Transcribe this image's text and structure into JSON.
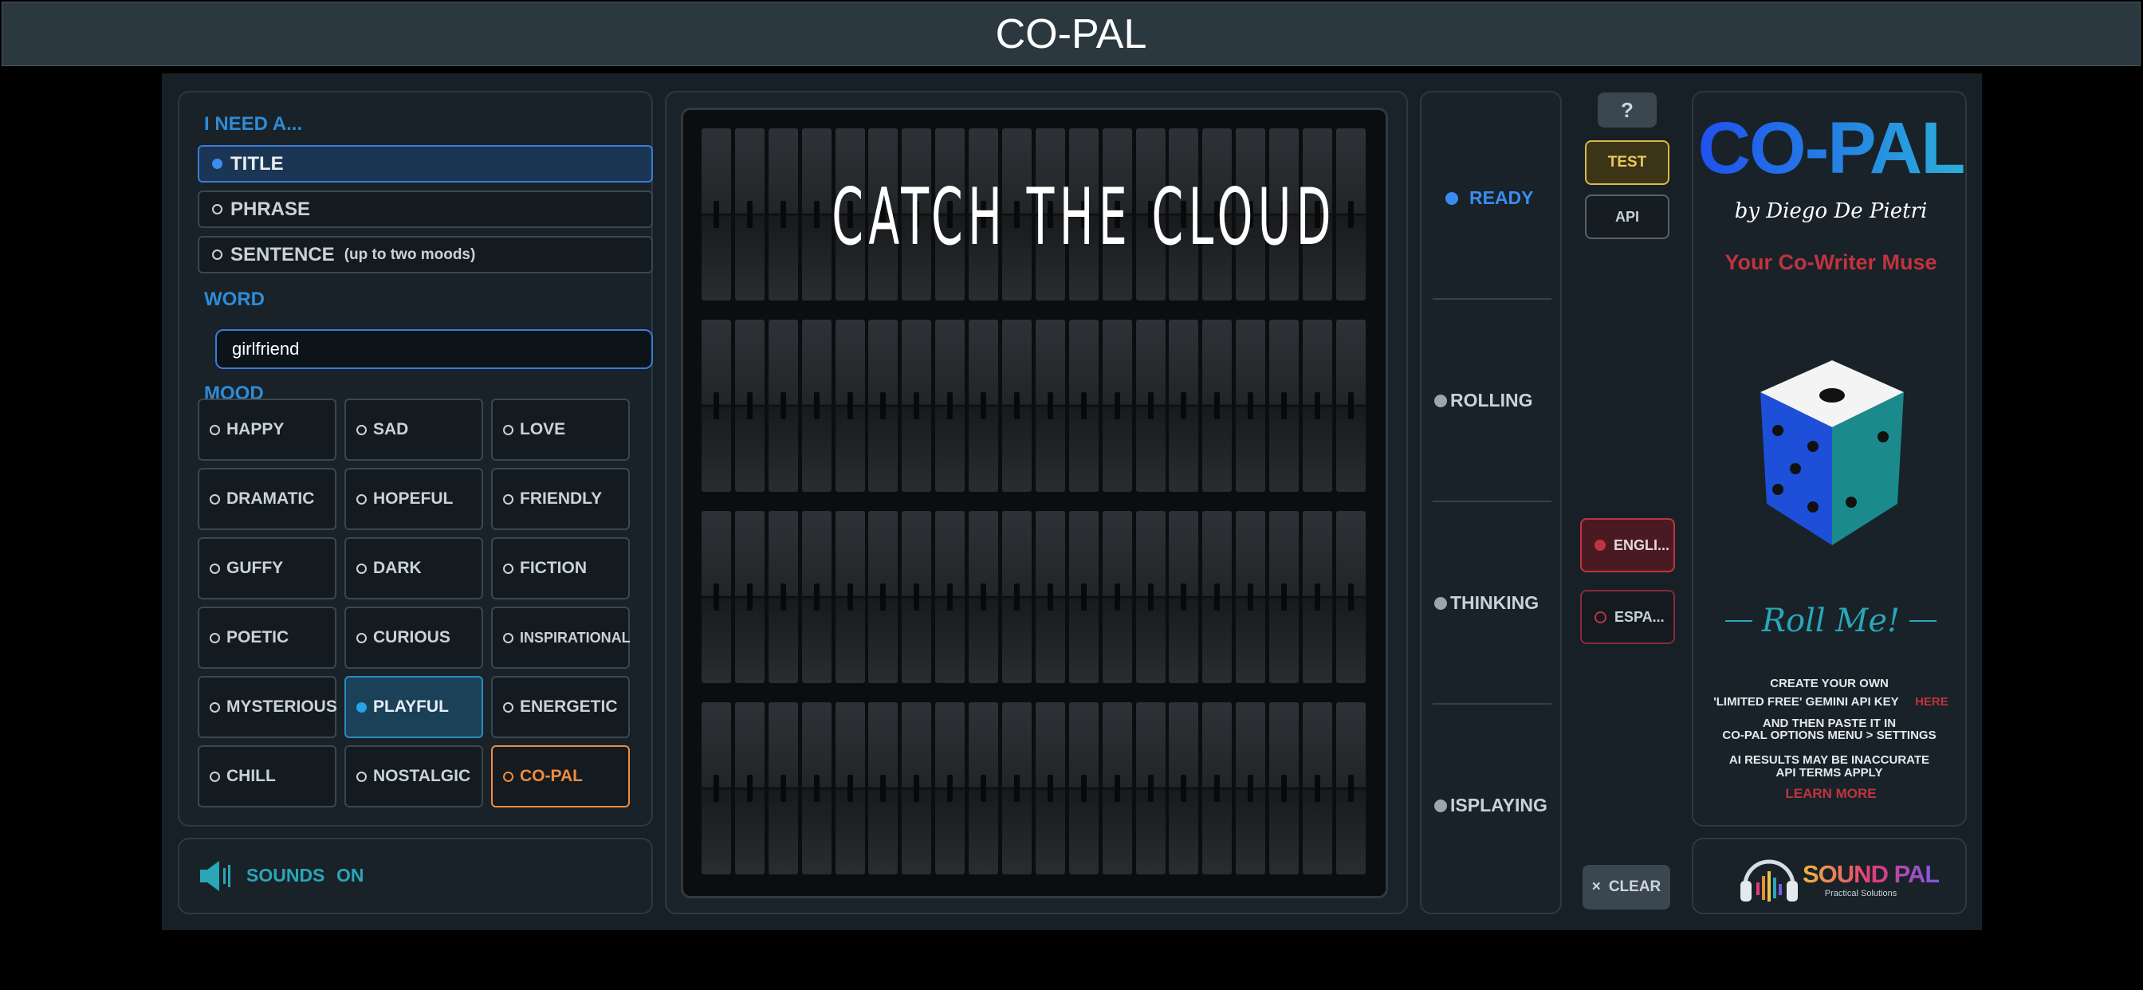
{
  "window": {
    "title": "CO-PAL"
  },
  "left": {
    "need_heading": "I NEED A...",
    "need_options": [
      {
        "label": "TITLE",
        "note": "",
        "selected": true
      },
      {
        "label": "PHRASE",
        "note": "",
        "selected": false
      },
      {
        "label": "SENTENCE",
        "note": "(up to two moods)",
        "selected": false
      }
    ],
    "word_heading": "WORD",
    "word_value": "girlfriend",
    "mood_heading": "MOOD",
    "moods": [
      "HAPPY",
      "SAD",
      "LOVE",
      "DRAMATIC",
      "HOPEFUL",
      "FRIENDLY",
      "GUFFY",
      "DARK",
      "FICTION",
      "POETIC",
      "CURIOUS",
      "INSPIRATIONAL",
      "MYSTERIOUS",
      "PLAYFUL",
      "ENERGETIC",
      "CHILL",
      "NOSTALGIC",
      "CO-PAL"
    ],
    "mood_selected": "PLAYFUL",
    "sounds": {
      "label": "SOUNDS",
      "state": "ON"
    }
  },
  "board": {
    "text": "CATCH THE CLOUD"
  },
  "status": {
    "items": [
      {
        "label": "READY",
        "active": true
      },
      {
        "label": "ROLLING",
        "active": false
      },
      {
        "label": "THINKING",
        "active": false
      },
      {
        "label": "ISPLAYING",
        "active": false
      }
    ]
  },
  "controls": {
    "help": "?",
    "test": "TEST",
    "api": "API",
    "english": "ENGLI...",
    "espanol": "ESPA...",
    "clear_icon": "×",
    "clear": "CLEAR"
  },
  "brand": {
    "logo": "CO-PAL",
    "byline": "by Diego De Pietri",
    "tagline": "Your Co-Writer Muse",
    "roll": "Roll Me!",
    "info": {
      "line1": "CREATE YOUR OWN",
      "line2": "'LIMITED FREE' GEMINI API KEY",
      "here": "HERE",
      "line3": "AND THEN PASTE IT IN",
      "line4": "CO-PAL OPTIONS MENU > SETTINGS",
      "line5": "AI RESULTS MAY BE INACCURATE",
      "line6": "API TERMS APPLY",
      "learn_more": "LEARN MORE"
    },
    "soundpal": {
      "name": "SOUND PAL",
      "subtitle": "Practical Solutions"
    }
  },
  "colors": {
    "accent_blue": "#3c8cf0",
    "accent_red": "#c0333f",
    "accent_orange": "#f08b3c",
    "accent_teal": "#2aa6b8"
  }
}
